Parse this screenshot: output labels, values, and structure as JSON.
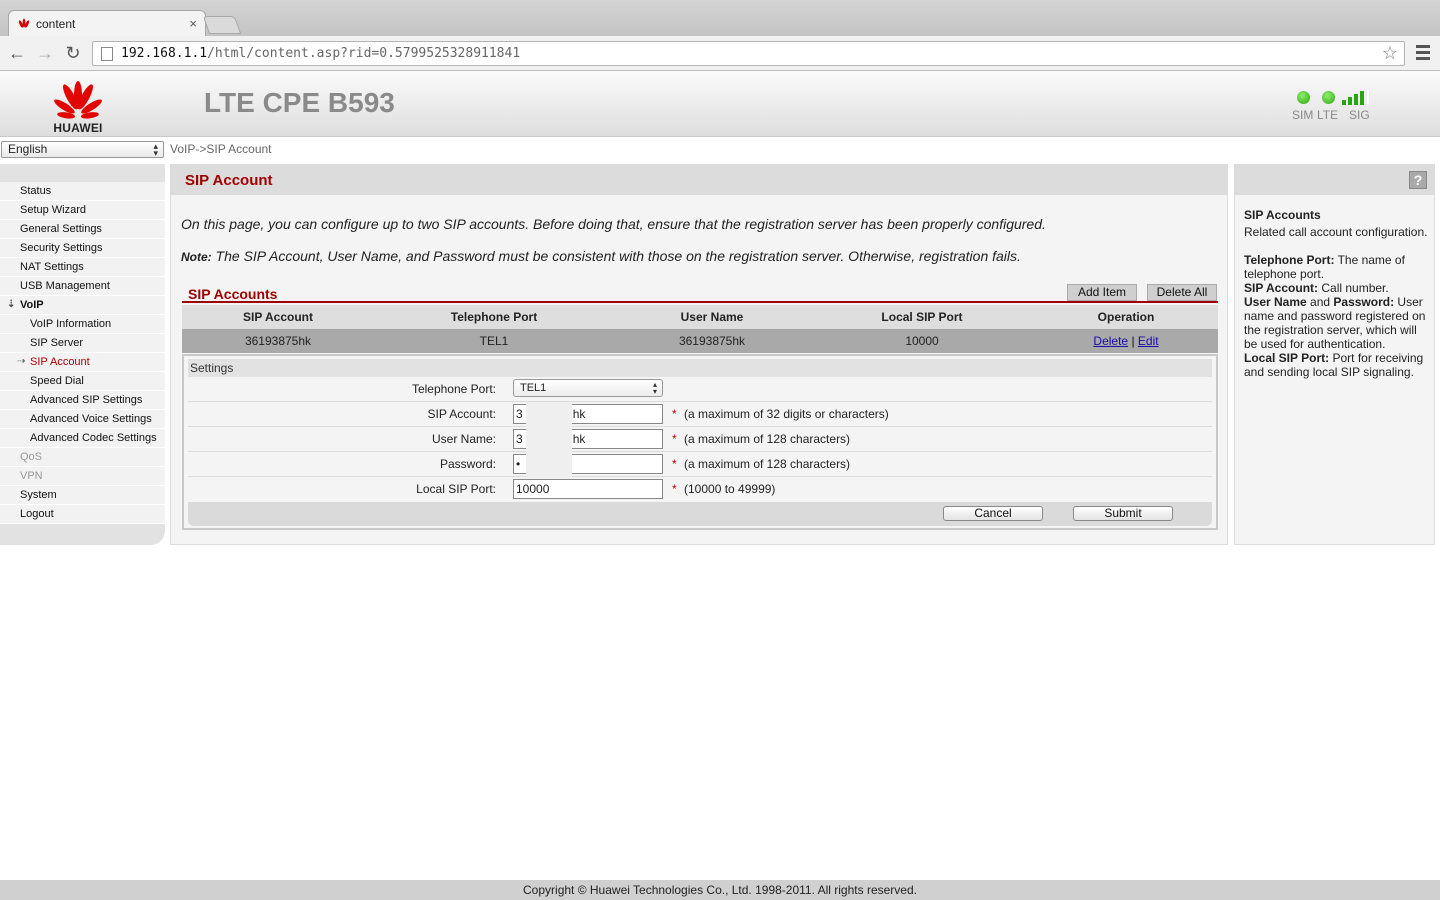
{
  "browser": {
    "tab_title": "content",
    "tab_close": "×",
    "url_host": "192.168.1.1",
    "url_path": "/html/content.asp?rid=0.5799525328911841",
    "back_glyph": "←",
    "forward_glyph": "→",
    "reload_glyph": "↻",
    "star_glyph": "☆"
  },
  "header": {
    "brand": "HUAWEI",
    "product": "LTE CPE B593",
    "status": {
      "sim_label": "SIM",
      "lte_label": "LTE",
      "sig_label": "SIG",
      "led_color": "#2aa512",
      "signal_bars_active": 4,
      "signal_bars_total": 5
    }
  },
  "language": {
    "selected": "English"
  },
  "breadcrumb": "VoIP->SIP Account",
  "sidebar": {
    "items": [
      {
        "label": "Status",
        "name": "status"
      },
      {
        "label": "Setup Wizard",
        "name": "setup-wizard"
      },
      {
        "label": "General Settings",
        "name": "general-settings"
      },
      {
        "label": "Security Settings",
        "name": "security-settings"
      },
      {
        "label": "NAT Settings",
        "name": "nat-settings"
      },
      {
        "label": "USB Management",
        "name": "usb-management"
      },
      {
        "label": "VoIP",
        "name": "voip",
        "marker": "⇣"
      },
      {
        "label": "VoIP Information",
        "name": "voip-information"
      },
      {
        "label": "SIP Server",
        "name": "sip-server"
      },
      {
        "label": "SIP Account",
        "name": "sip-account",
        "marker": "⇢"
      },
      {
        "label": "Speed Dial",
        "name": "speed-dial"
      },
      {
        "label": "Advanced SIP Settings",
        "name": "advanced-sip-settings"
      },
      {
        "label": "Advanced Voice Settings",
        "name": "advanced-voice-settings"
      },
      {
        "label": "Advanced Codec Settings",
        "name": "advanced-codec-settings"
      },
      {
        "label": "QoS",
        "name": "qos"
      },
      {
        "label": "VPN",
        "name": "vpn"
      },
      {
        "label": "System",
        "name": "system"
      },
      {
        "label": "Logout",
        "name": "logout"
      }
    ]
  },
  "main": {
    "title": "SIP Account",
    "intro": "On this page, you can configure up to two SIP accounts. Before doing that, ensure that the registration server has been properly configured.",
    "note_label": "Note:",
    "note_text": " The SIP Account, User Name, and Password must be consistent with those on the registration server. Otherwise, registration fails.",
    "section_title": "SIP Accounts",
    "add_item": "Add Item",
    "delete_all": "Delete All",
    "table": {
      "headers": [
        "SIP Account",
        "Telephone Port",
        "User Name",
        "Local SIP Port",
        "Operation"
      ],
      "rows": [
        {
          "sip_account": "36193875hk",
          "telephone_port": "TEL1",
          "user_name": "36193875hk",
          "local_sip_port": "10000",
          "delete": "Delete",
          "sep": "|",
          "edit": "Edit"
        }
      ]
    },
    "settings": {
      "heading": "Settings",
      "telephone_port_label": "Telephone Port:",
      "telephone_port_value": "TEL1",
      "sip_account_label": "SIP Account:",
      "sip_account_value_start": "3",
      "sip_account_value_end": "hk",
      "sip_account_hint": "(a maximum of 32 digits or characters)",
      "user_name_label": "User Name:",
      "user_name_value_start": "3",
      "user_name_value_end": "hk",
      "user_name_hint": "(a maximum of 128 characters)",
      "password_label": "Password:",
      "password_value": "•",
      "password_hint": "(a maximum of 128 characters)",
      "local_sip_port_label": "Local SIP Port:",
      "local_sip_port_value": "10000",
      "local_sip_port_hint": "(10000 to 49999)",
      "required_mark": "*",
      "cancel": "Cancel",
      "submit": "Submit"
    }
  },
  "help": {
    "button": "?",
    "title": "SIP Accounts",
    "intro": "Related call account configuration.",
    "telephone_port_term": "Telephone Port:",
    "telephone_port_desc": " The name of telephone port.",
    "sip_account_term": "SIP Account:",
    "sip_account_desc": " Call number.",
    "user_name_term": "User Name",
    "and_word": " and ",
    "password_term": "Password:",
    "user_pass_desc": " User name and password registered on the registration server, which will be used for authentication.",
    "local_sip_port_term": "Local SIP Port:",
    "local_sip_port_desc": " Port for receiving and sending local SIP signaling."
  },
  "footer": "Copyright © Huawei Technologies Co., Ltd. 1998-2011. All rights reserved."
}
